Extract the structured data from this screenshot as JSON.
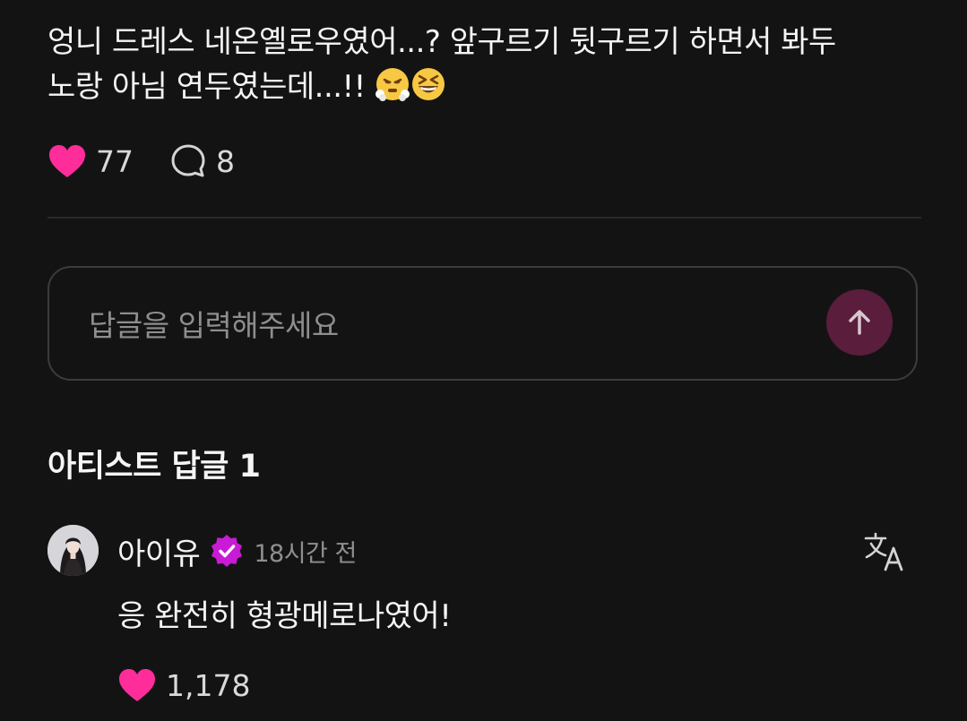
{
  "post": {
    "text": "엉니 드레스 네온옐로우였어...? 앞구르기 뒷구르기 하면서 봐두\n노랑 아님 연두였는데...!! ",
    "emojis": [
      "face-with-steam-emoji",
      "grinning-squinting-face-emoji"
    ],
    "like_count": "77",
    "reply_count": "8"
  },
  "reply_box": {
    "placeholder": "답글을 입력해주세요"
  },
  "artist_replies": {
    "title": "아티스트 답글 1",
    "items": [
      {
        "author": "아이유",
        "timestamp": "18시간 전",
        "text": "응 완전히 형광메로나였어!",
        "like_count": "1,178"
      }
    ]
  },
  "colors": {
    "background": "#141314",
    "heart": "#ff2d9a",
    "send_button": "#5a1d3c",
    "verified_badge": "#c81bd6"
  }
}
